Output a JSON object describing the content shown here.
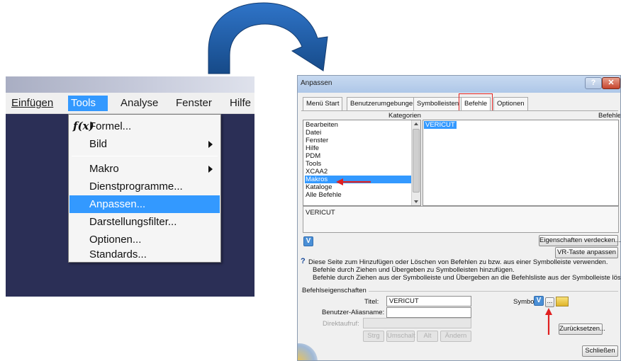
{
  "menu_window": {
    "menubar": [
      {
        "label": "Einfügen"
      },
      {
        "label": "Tools"
      },
      {
        "label": "Analyse"
      },
      {
        "label": "Fenster"
      },
      {
        "label": "Hilfe"
      }
    ],
    "dropdown": [
      {
        "label": "Formel..."
      },
      {
        "label": "Bild"
      },
      {
        "label": "Makro"
      },
      {
        "label": "Dienstprogramme..."
      },
      {
        "label": "Anpassen..."
      },
      {
        "label": "Darstellungsfilter..."
      },
      {
        "label": "Optionen..."
      },
      {
        "label": "Standards..."
      }
    ]
  },
  "dialog": {
    "title": "Anpassen",
    "tabs": [
      {
        "label": "Menü Start"
      },
      {
        "label": "Benutzerumgebungen"
      },
      {
        "label": "Symbolleisten"
      },
      {
        "label": "Befehle"
      },
      {
        "label": "Optionen"
      }
    ],
    "categories_label": "Kategorien",
    "commands_label": "Befehle",
    "categories": [
      "Bearbeiten",
      "Datei",
      "Fenster",
      "Hilfe",
      "PDM",
      "Tools",
      "XCAA2",
      "Makros",
      "Kataloge",
      "Alle Befehle"
    ],
    "commands": [
      "VERICUT"
    ],
    "description": "VERICUT",
    "buttons": {
      "hide_properties": "Eigenschaften verdecken...",
      "vr_key": "VR-Taste anpassen",
      "reset": "Zurücksetzen...",
      "close": "Schließen",
      "browse": "...",
      "ctrl": "Strg",
      "shift": "Umschalt",
      "alt": "Alt",
      "change": "Ändern"
    },
    "info_lines": [
      "Diese Seite zum Hinzufügen oder Löschen von Befehlen zu bzw. aus einer Symbolleiste verwenden.",
      "Befehle durch Ziehen und Übergeben zu Symbolleisten hinzufügen.",
      "Befehle durch Ziehen aus der Symbolleiste und Übergeben an die Befehlsliste aus der Symbolleiste löschen."
    ],
    "properties": {
      "group_label": "Befehlseigenschaften",
      "title_label": "Titel:",
      "title_value": "VERICUT",
      "alias_label": "Benutzer-Aliasname:",
      "alias_value": "",
      "shortcut_label": "Direktaufruf:",
      "symbol_label": "Symbol:"
    }
  },
  "colors": {
    "arrow": "#1f5a9e",
    "selection": "#3399ff",
    "highlight": "#e02020",
    "dark_background": "#2b2f56"
  }
}
